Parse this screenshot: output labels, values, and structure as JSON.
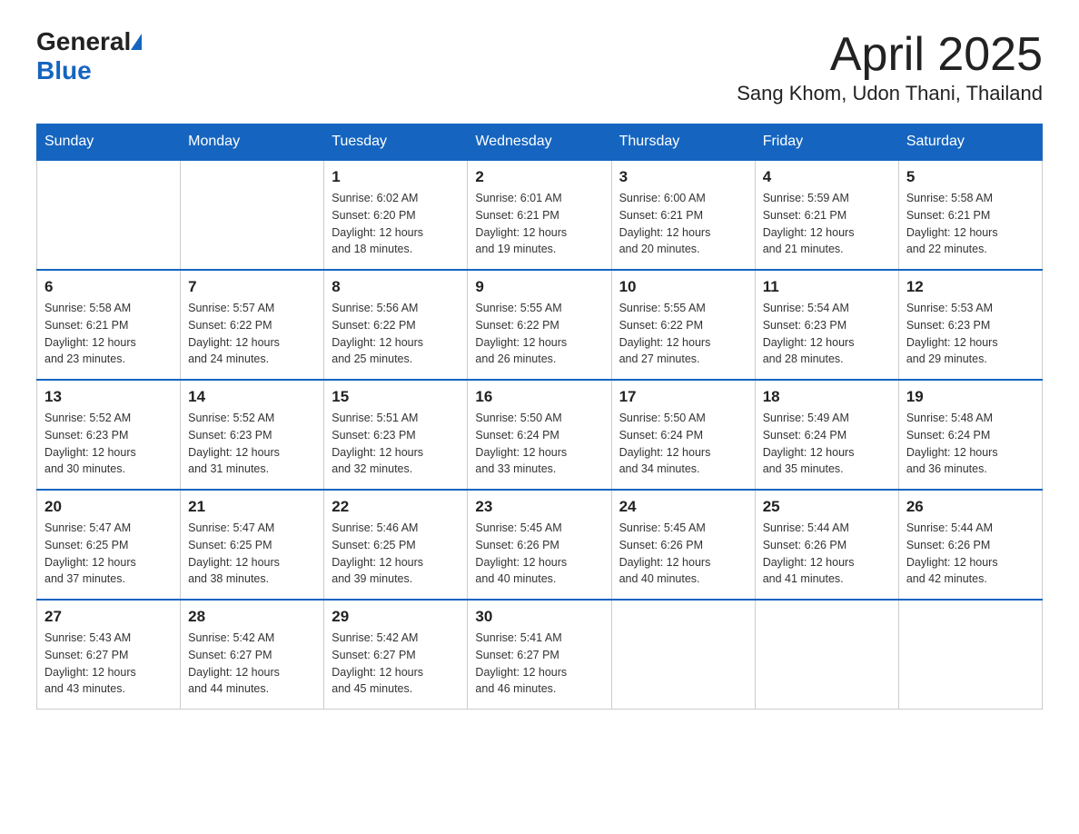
{
  "header": {
    "logo_general": "General",
    "logo_blue": "Blue",
    "title": "April 2025",
    "subtitle": "Sang Khom, Udon Thani, Thailand"
  },
  "weekdays": [
    "Sunday",
    "Monday",
    "Tuesday",
    "Wednesday",
    "Thursday",
    "Friday",
    "Saturday"
  ],
  "weeks": [
    [
      {
        "day": "",
        "detail": ""
      },
      {
        "day": "",
        "detail": ""
      },
      {
        "day": "1",
        "detail": "Sunrise: 6:02 AM\nSunset: 6:20 PM\nDaylight: 12 hours\nand 18 minutes."
      },
      {
        "day": "2",
        "detail": "Sunrise: 6:01 AM\nSunset: 6:21 PM\nDaylight: 12 hours\nand 19 minutes."
      },
      {
        "day": "3",
        "detail": "Sunrise: 6:00 AM\nSunset: 6:21 PM\nDaylight: 12 hours\nand 20 minutes."
      },
      {
        "day": "4",
        "detail": "Sunrise: 5:59 AM\nSunset: 6:21 PM\nDaylight: 12 hours\nand 21 minutes."
      },
      {
        "day": "5",
        "detail": "Sunrise: 5:58 AM\nSunset: 6:21 PM\nDaylight: 12 hours\nand 22 minutes."
      }
    ],
    [
      {
        "day": "6",
        "detail": "Sunrise: 5:58 AM\nSunset: 6:21 PM\nDaylight: 12 hours\nand 23 minutes."
      },
      {
        "day": "7",
        "detail": "Sunrise: 5:57 AM\nSunset: 6:22 PM\nDaylight: 12 hours\nand 24 minutes."
      },
      {
        "day": "8",
        "detail": "Sunrise: 5:56 AM\nSunset: 6:22 PM\nDaylight: 12 hours\nand 25 minutes."
      },
      {
        "day": "9",
        "detail": "Sunrise: 5:55 AM\nSunset: 6:22 PM\nDaylight: 12 hours\nand 26 minutes."
      },
      {
        "day": "10",
        "detail": "Sunrise: 5:55 AM\nSunset: 6:22 PM\nDaylight: 12 hours\nand 27 minutes."
      },
      {
        "day": "11",
        "detail": "Sunrise: 5:54 AM\nSunset: 6:23 PM\nDaylight: 12 hours\nand 28 minutes."
      },
      {
        "day": "12",
        "detail": "Sunrise: 5:53 AM\nSunset: 6:23 PM\nDaylight: 12 hours\nand 29 minutes."
      }
    ],
    [
      {
        "day": "13",
        "detail": "Sunrise: 5:52 AM\nSunset: 6:23 PM\nDaylight: 12 hours\nand 30 minutes."
      },
      {
        "day": "14",
        "detail": "Sunrise: 5:52 AM\nSunset: 6:23 PM\nDaylight: 12 hours\nand 31 minutes."
      },
      {
        "day": "15",
        "detail": "Sunrise: 5:51 AM\nSunset: 6:23 PM\nDaylight: 12 hours\nand 32 minutes."
      },
      {
        "day": "16",
        "detail": "Sunrise: 5:50 AM\nSunset: 6:24 PM\nDaylight: 12 hours\nand 33 minutes."
      },
      {
        "day": "17",
        "detail": "Sunrise: 5:50 AM\nSunset: 6:24 PM\nDaylight: 12 hours\nand 34 minutes."
      },
      {
        "day": "18",
        "detail": "Sunrise: 5:49 AM\nSunset: 6:24 PM\nDaylight: 12 hours\nand 35 minutes."
      },
      {
        "day": "19",
        "detail": "Sunrise: 5:48 AM\nSunset: 6:24 PM\nDaylight: 12 hours\nand 36 minutes."
      }
    ],
    [
      {
        "day": "20",
        "detail": "Sunrise: 5:47 AM\nSunset: 6:25 PM\nDaylight: 12 hours\nand 37 minutes."
      },
      {
        "day": "21",
        "detail": "Sunrise: 5:47 AM\nSunset: 6:25 PM\nDaylight: 12 hours\nand 38 minutes."
      },
      {
        "day": "22",
        "detail": "Sunrise: 5:46 AM\nSunset: 6:25 PM\nDaylight: 12 hours\nand 39 minutes."
      },
      {
        "day": "23",
        "detail": "Sunrise: 5:45 AM\nSunset: 6:26 PM\nDaylight: 12 hours\nand 40 minutes."
      },
      {
        "day": "24",
        "detail": "Sunrise: 5:45 AM\nSunset: 6:26 PM\nDaylight: 12 hours\nand 40 minutes."
      },
      {
        "day": "25",
        "detail": "Sunrise: 5:44 AM\nSunset: 6:26 PM\nDaylight: 12 hours\nand 41 minutes."
      },
      {
        "day": "26",
        "detail": "Sunrise: 5:44 AM\nSunset: 6:26 PM\nDaylight: 12 hours\nand 42 minutes."
      }
    ],
    [
      {
        "day": "27",
        "detail": "Sunrise: 5:43 AM\nSunset: 6:27 PM\nDaylight: 12 hours\nand 43 minutes."
      },
      {
        "day": "28",
        "detail": "Sunrise: 5:42 AM\nSunset: 6:27 PM\nDaylight: 12 hours\nand 44 minutes."
      },
      {
        "day": "29",
        "detail": "Sunrise: 5:42 AM\nSunset: 6:27 PM\nDaylight: 12 hours\nand 45 minutes."
      },
      {
        "day": "30",
        "detail": "Sunrise: 5:41 AM\nSunset: 6:27 PM\nDaylight: 12 hours\nand 46 minutes."
      },
      {
        "day": "",
        "detail": ""
      },
      {
        "day": "",
        "detail": ""
      },
      {
        "day": "",
        "detail": ""
      }
    ]
  ]
}
